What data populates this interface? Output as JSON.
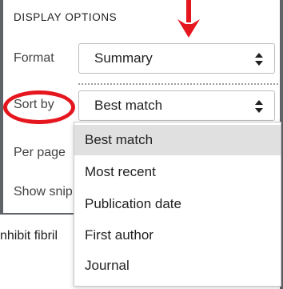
{
  "panel": {
    "heading": "DISPLAY OPTIONS",
    "format": {
      "label": "Format",
      "value": "Summary"
    },
    "sort": {
      "label": "Sort by",
      "value": "Best match"
    },
    "per_page": {
      "label": "Per page"
    },
    "snippets": {
      "label": "Show snip"
    }
  },
  "dropdown": {
    "options": [
      "Best match",
      "Most recent",
      "Publication date",
      "First author",
      "Journal"
    ],
    "highlighted": "Best match"
  },
  "background_text": "nhibit fibril",
  "annotations": {
    "color": "#e5161e"
  }
}
